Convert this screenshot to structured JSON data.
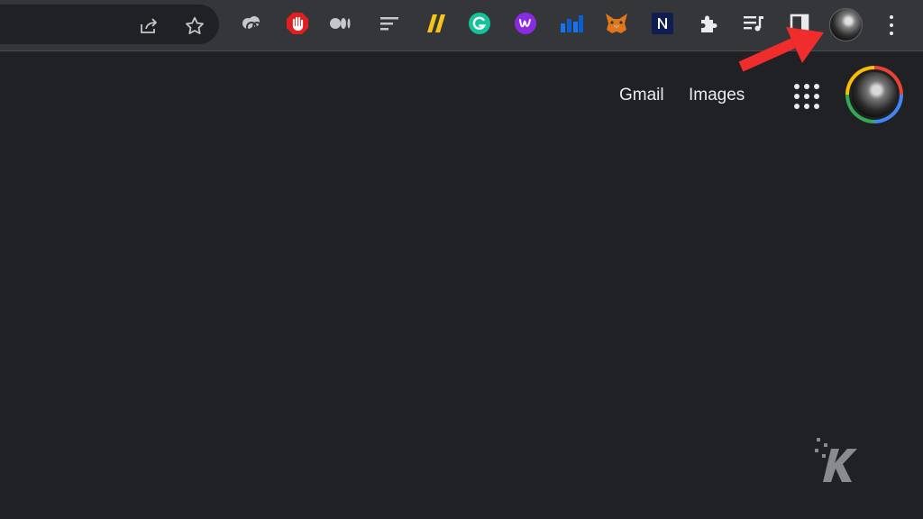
{
  "browser": {
    "omnibox": {
      "share_icon": "share-icon",
      "star_icon": "bookmark-star-icon"
    },
    "extensions": [
      {
        "name": "cloud-link-extension-icon",
        "color": "#c5c7ca"
      },
      {
        "name": "ad-blocker-hand-extension-icon",
        "color": "#e0201f"
      },
      {
        "name": "medium-extension-icon",
        "color": "#c5c7ca"
      },
      {
        "name": "reader-lines-extension-icon",
        "color": "#c5c7ca"
      },
      {
        "name": "slash-yellow-extension-icon",
        "color": "#f5c518"
      },
      {
        "name": "grammarly-extension-icon",
        "color": "#15c39a"
      },
      {
        "name": "wordtune-extension-icon",
        "color": "#8a2be2"
      },
      {
        "name": "bar-chart-extension-icon",
        "color": "#1a73e8"
      },
      {
        "name": "metamask-fox-extension-icon",
        "color": "#e2761b"
      },
      {
        "name": "notion-n-extension-icon",
        "color": "#1b2a6b"
      },
      {
        "name": "puzzle-extensions-icon",
        "color": "#e8eaed"
      },
      {
        "name": "media-control-icon",
        "color": "#e8eaed"
      },
      {
        "name": "side-panel-icon",
        "color": "#e8eaed"
      }
    ],
    "profile_icon": "profile-avatar-icon",
    "menu_icon": "kebab-menu-icon"
  },
  "header": {
    "gmail_label": "Gmail",
    "images_label": "Images",
    "apps_icon": "google-apps-grid-icon",
    "account_icon": "google-account-avatar"
  },
  "annotation": {
    "arrow_color": "#f02c2c"
  },
  "watermark": {
    "logo": "K"
  }
}
